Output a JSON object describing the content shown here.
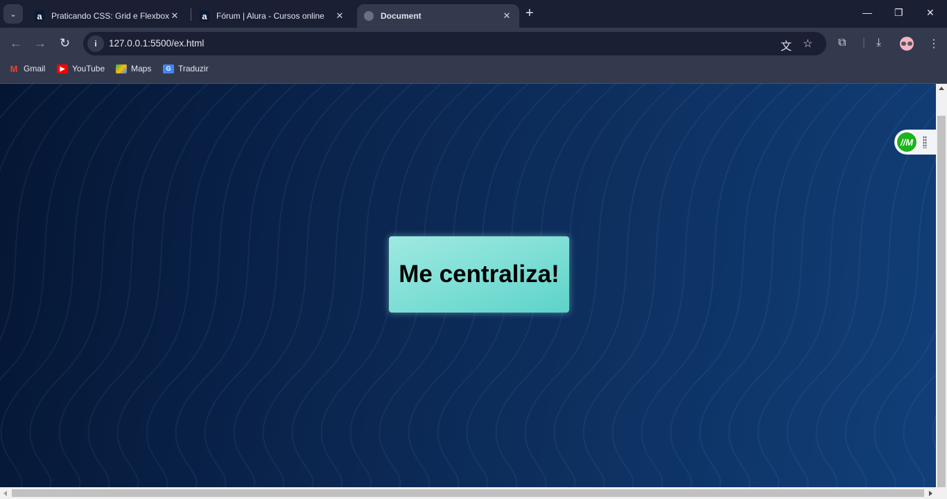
{
  "tabs": [
    {
      "title": "Praticando CSS: Grid e Flexbox",
      "icon": "alura-icon",
      "active": false
    },
    {
      "title": "Fórum | Alura - Cursos online",
      "icon": "alura-icon",
      "active": false
    },
    {
      "title": "Document",
      "icon": "globe-icon",
      "active": true
    }
  ],
  "toolbar": {
    "url": "127.0.0.1:5500/ex.html"
  },
  "bookmarks": [
    {
      "label": "Gmail",
      "icon": "gmail-icon",
      "color": "#ea4335"
    },
    {
      "label": "YouTube",
      "icon": "youtube-icon",
      "color": "#ff0000"
    },
    {
      "label": "Maps",
      "icon": "maps-icon",
      "color": "#34a853"
    },
    {
      "label": "Traduzir",
      "icon": "translate-icon",
      "color": "#4285f4"
    }
  ],
  "page": {
    "box_text": "Me centraliza!",
    "box_color": "#7fdfd6",
    "background_color": "#0b2650"
  },
  "widget": {
    "logo_text": "IM",
    "color": "#1db31d"
  }
}
